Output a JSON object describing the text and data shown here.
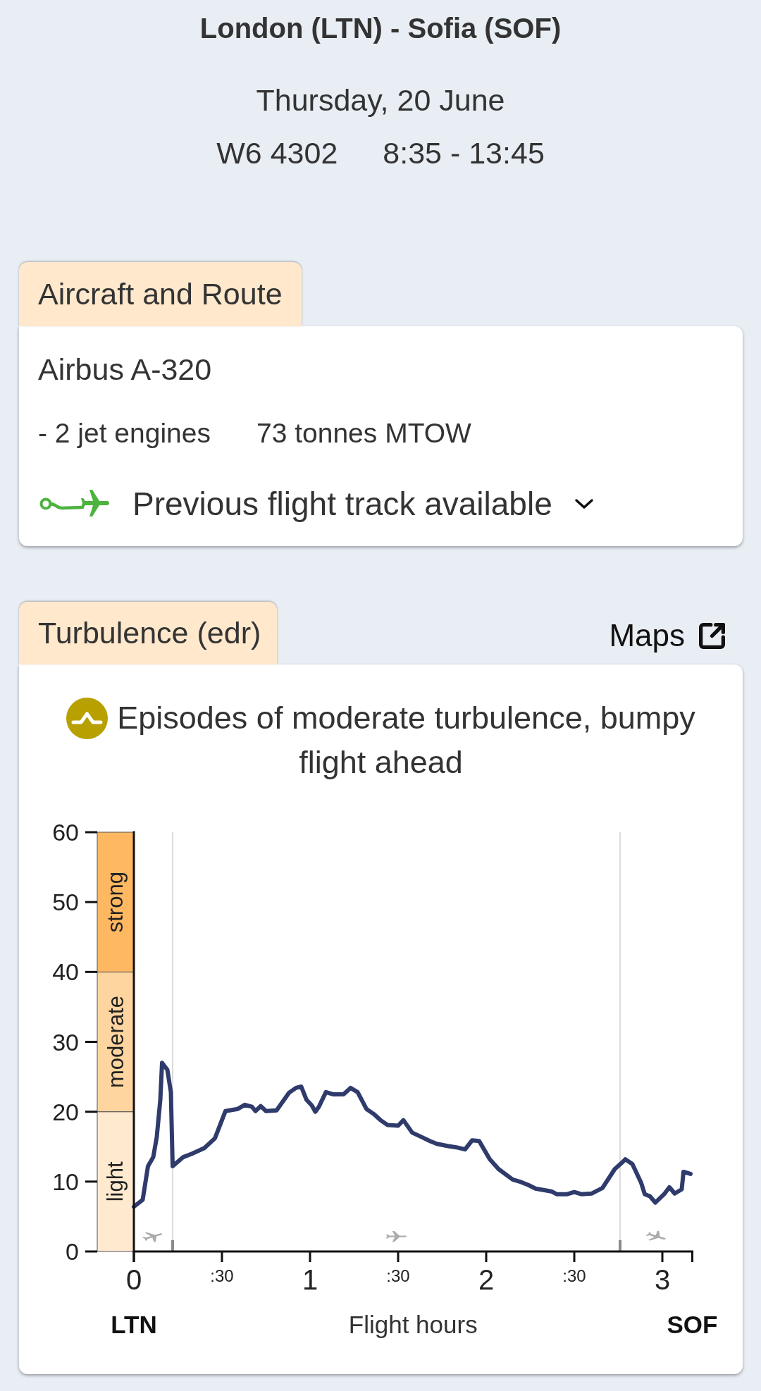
{
  "header": {
    "route": "London (LTN) - Sofia (SOF)",
    "date": "Thursday, 20 June",
    "flight_number": "W6 4302",
    "times": "8:35 - 13:45"
  },
  "aircraft": {
    "title": "Aircraft and Route",
    "model": "Airbus A-320",
    "engines": "- 2 jet engines",
    "weight": "73 tonnes MTOW",
    "track": {
      "label": "Previous flight track available",
      "expanded": false
    }
  },
  "turbulence": {
    "title": "Turbulence (edr)",
    "maps_link": "Maps",
    "summary": {
      "text": "Episodes of moderate turbulence, bumpy flight ahead"
    },
    "severity_scale": [
      {
        "label": "light",
        "color": "#ffe9cf"
      },
      {
        "label": "moderate",
        "color": "#ffd59f"
      },
      {
        "label": "strong",
        "color": "#ffb862"
      }
    ],
    "half_hour_labels": [
      ":30",
      ":30",
      ":30"
    ],
    "route_codes": {
      "origin": "LTN",
      "destination": "SOF"
    },
    "chart_data": {
      "type": "line",
      "xlabel": "Flight hours",
      "x": [
        0,
        0.05,
        0.08,
        0.11,
        0.13,
        0.15,
        0.16,
        0.19,
        0.21,
        0.22,
        0.28,
        0.33,
        0.4,
        0.46,
        0.52,
        0.59,
        0.63,
        0.67,
        0.69,
        0.72,
        0.75,
        0.81,
        0.88,
        0.92,
        0.95,
        0.98,
        1.01,
        1.03,
        1.05,
        1.09,
        1.13,
        1.19,
        1.23,
        1.27,
        1.32,
        1.36,
        1.4,
        1.44,
        1.5,
        1.53,
        1.58,
        1.64,
        1.68,
        1.72,
        1.78,
        1.83,
        1.88,
        1.92,
        1.96,
        2.02,
        2.07,
        2.15,
        2.19,
        2.24,
        2.28,
        2.37,
        2.4,
        2.46,
        2.5,
        2.54,
        2.6,
        2.66,
        2.73,
        2.77,
        2.79,
        2.83,
        2.88,
        2.9,
        2.93,
        2.96,
        3.01,
        3.04,
        3.07,
        3.11,
        3.12,
        3.16
      ],
      "values": [
        6.4,
        7.4,
        12.2,
        13.5,
        16.4,
        21.7,
        27.0,
        26.0,
        22.8,
        12.2,
        13.5,
        14.0,
        14.8,
        16.2,
        20.1,
        20.4,
        21.0,
        20.7,
        20.1,
        20.8,
        20.1,
        20.2,
        22.7,
        23.4,
        23.6,
        21.7,
        20.9,
        20.0,
        20.7,
        22.8,
        22.5,
        22.5,
        23.4,
        22.8,
        20.4,
        19.7,
        18.8,
        18.1,
        18.0,
        18.8,
        17.0,
        16.3,
        15.8,
        15.4,
        15.1,
        14.9,
        14.6,
        15.9,
        15.8,
        13.2,
        11.8,
        10.3,
        10.0,
        9.5,
        9.0,
        8.6,
        8.2,
        8.2,
        8.5,
        8.2,
        8.3,
        9.1,
        11.8,
        12.7,
        13.2,
        12.5,
        9.8,
        8.2,
        7.9,
        7.0,
        8.2,
        9.2,
        8.3,
        8.9,
        11.4,
        11.1
      ],
      "xlim": [
        0,
        3.17
      ],
      "ylim": [
        0,
        60
      ],
      "xticks": [
        0,
        1,
        2,
        3
      ],
      "yticks": [
        0,
        10,
        20,
        30,
        40,
        50,
        60
      ],
      "ref_lines": [
        {
          "axis": "x",
          "value": 0.22
        },
        {
          "axis": "x",
          "value": 2.76
        }
      ]
    }
  }
}
